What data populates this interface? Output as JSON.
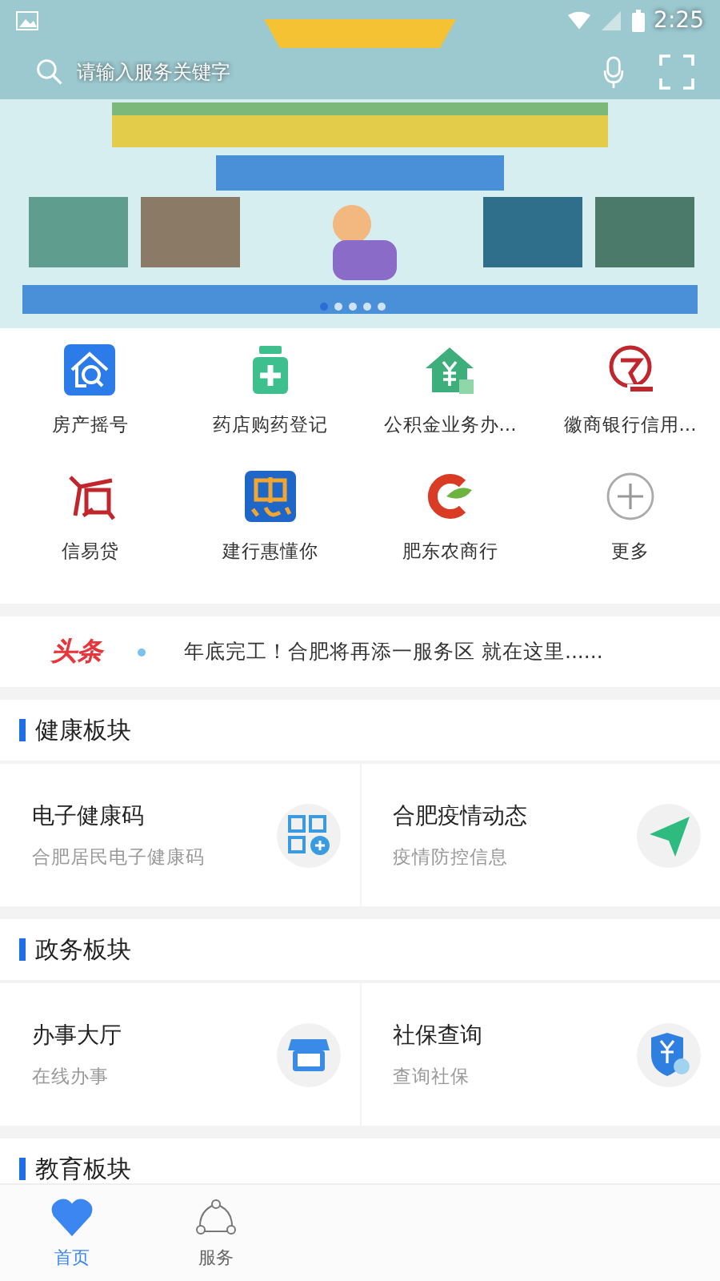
{
  "status_bar": {
    "time": "2:25"
  },
  "search": {
    "placeholder": "请输入服务关键字"
  },
  "banner": {
    "dots": [
      {
        "selected": true
      },
      {
        "selected": false
      },
      {
        "selected": false
      },
      {
        "selected": false
      },
      {
        "selected": false
      }
    ]
  },
  "services": [
    {
      "label": "房产摇号",
      "kind": "house-search"
    },
    {
      "label": "药店购药登记",
      "kind": "medicine"
    },
    {
      "label": "公积金业务办...",
      "kind": "house-yuan"
    },
    {
      "label": "徽商银行信用...",
      "kind": "bank"
    },
    {
      "label": "信易贷",
      "kind": "credit"
    },
    {
      "label": "建行惠懂你",
      "kind": "hui"
    },
    {
      "label": "肥东农商行",
      "kind": "rural-bank"
    },
    {
      "label": "更多",
      "kind": "plus"
    }
  ],
  "headline": {
    "tag": "头条",
    "text": "年底完工！合肥将再添一服务区 就在这里......"
  },
  "sections": [
    {
      "title": "健康板块",
      "cards": [
        {
          "title": "电子健康码",
          "subtitle": "合肥居民电子健康码",
          "kind": "qr"
        },
        {
          "title": "合肥疫情动态",
          "subtitle": "疫情防控信息",
          "kind": "plane"
        }
      ]
    },
    {
      "title": "政务板块",
      "cards": [
        {
          "title": "办事大厅",
          "subtitle": "在线办事",
          "kind": "shop"
        },
        {
          "title": "社保查询",
          "subtitle": "查询社保",
          "kind": "shield"
        }
      ]
    },
    {
      "title": "教育板块"
    }
  ],
  "tab_bar": [
    {
      "label": "首页",
      "kind": "heart",
      "selected": true
    },
    {
      "label": "服务",
      "kind": "share",
      "selected": false
    }
  ]
}
